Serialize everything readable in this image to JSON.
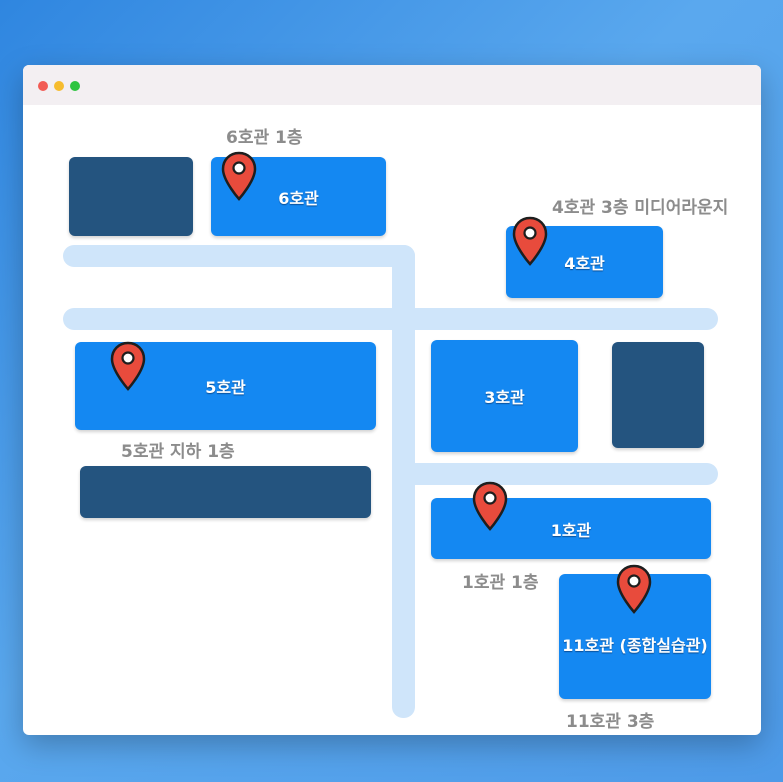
{
  "window": {
    "controls": [
      "close",
      "minimize",
      "maximize"
    ],
    "colors": {
      "close": "#f25b54",
      "minimize": "#f6bc2e",
      "maximize": "#2dc43f"
    }
  },
  "buildings": {
    "b6": "6호관",
    "b4": "4호관",
    "b5": "5호관",
    "b3": "3호관",
    "b1": "1호관",
    "b11": "11호관 (종합실습관)"
  },
  "labels": {
    "b6_floor": "6호관 1층",
    "b4_floor": "4호관 3층 미디어라운지",
    "b5_floor": "5호관 지하 1층",
    "b1_floor": "1호관 1층",
    "b11_floor": "11호관 3층"
  },
  "pins": [
    "map-pin-icon",
    "map-pin-icon",
    "map-pin-icon",
    "map-pin-icon",
    "map-pin-icon"
  ],
  "colors": {
    "building": "#1488f2",
    "building_dark": "#24547f",
    "road": "#cfe5fa",
    "pin": "#e84b3c",
    "label": "#8c8c8c"
  }
}
